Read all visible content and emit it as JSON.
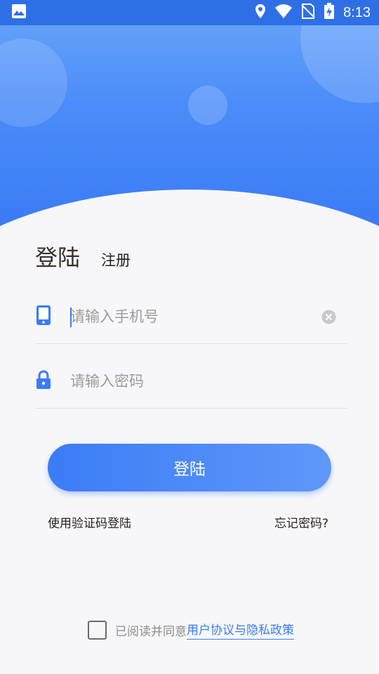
{
  "status_bar": {
    "time": "8:13",
    "icons": [
      "image-icon",
      "location-icon",
      "wifi-icon",
      "no-sim-icon",
      "battery-charging-icon"
    ]
  },
  "tabs": {
    "login": "登陆",
    "register": "注册"
  },
  "phone_field": {
    "placeholder": "请输入手机号",
    "value": "",
    "icon": "phone-icon",
    "clear_icon": "clear-icon"
  },
  "password_field": {
    "placeholder": "请输入密码",
    "value": "",
    "icon": "lock-icon"
  },
  "login_button": "登陆",
  "links": {
    "code_login": "使用验证码登陆",
    "forgot_password": "忘记密码?"
  },
  "agreement": {
    "checked": false,
    "prefix": "已阅读并同意",
    "link": "用户协议与隐私政策"
  },
  "colors": {
    "primary": "#3a7bf6",
    "header_top": "#6aa6fb",
    "status_bar": "#2f6fe6"
  }
}
